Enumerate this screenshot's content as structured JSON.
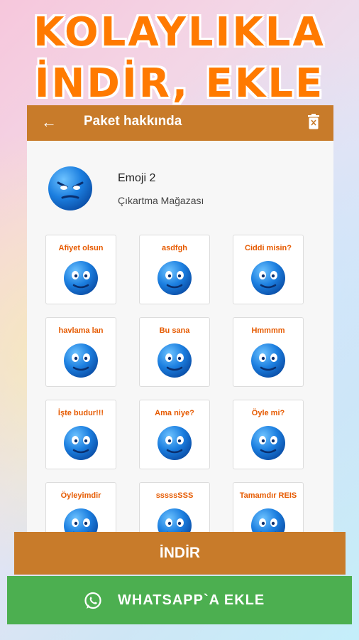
{
  "promo": {
    "line1": "KOLAYLIKLA",
    "line2": "İNDİR, EKLE"
  },
  "appbar": {
    "back_icon": "arrow-left-icon",
    "title": "Paket hakkında",
    "delete_icon": "trash-icon"
  },
  "pack": {
    "name": "Emoji 2",
    "publisher": "Çıkartma Mağazası"
  },
  "stickers": [
    {
      "caption": "Afiyet olsun"
    },
    {
      "caption": "asdfgh"
    },
    {
      "caption": "Ciddi misin?"
    },
    {
      "caption": "havlama lan"
    },
    {
      "caption": "Bu sana"
    },
    {
      "caption": "Hmmmm"
    },
    {
      "caption": "İşte budur!!!"
    },
    {
      "caption": "Ama niye?"
    },
    {
      "caption": "Öyle mi?"
    },
    {
      "caption": "Öyleyimdir"
    },
    {
      "caption": "sssssSSS"
    },
    {
      "caption": "Tamamdır REIS"
    }
  ],
  "buttons": {
    "download": "İNDİR",
    "whatsapp": "WHATSAPP`A EKLE"
  },
  "colors": {
    "appbar": "#c87b2a",
    "whatsapp": "#4caf50",
    "headline": "#ff7a00"
  }
}
